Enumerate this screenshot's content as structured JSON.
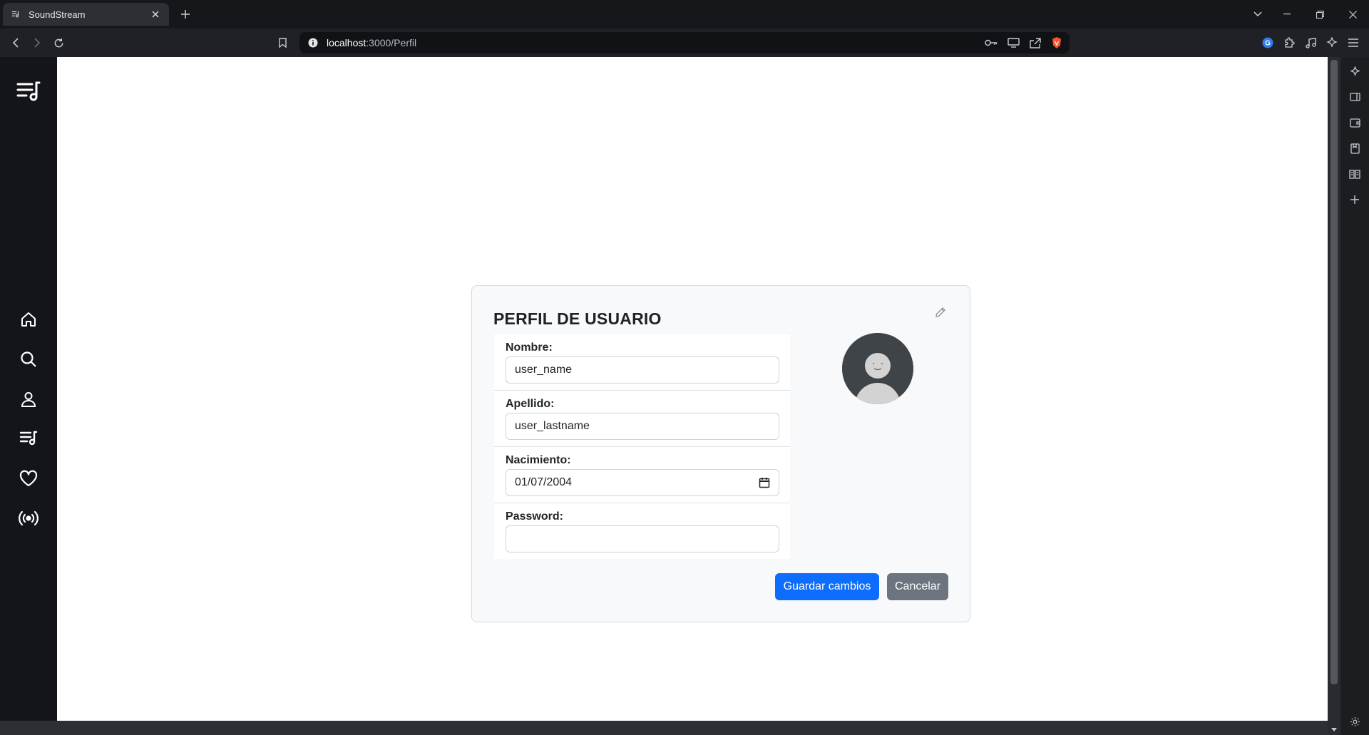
{
  "browser": {
    "tab_title": "SoundStream",
    "url_host": "localhost",
    "url_path": ":3000/Perfil"
  },
  "sidebar": {
    "items": [
      {
        "name": "home-icon"
      },
      {
        "name": "search-icon"
      },
      {
        "name": "user-icon"
      },
      {
        "name": "playlist-icon"
      },
      {
        "name": "heart-icon"
      },
      {
        "name": "broadcast-icon"
      }
    ]
  },
  "profile": {
    "title": "PERFIL DE USUARIO",
    "fields": [
      {
        "label": "Nombre:",
        "value": "user_name"
      },
      {
        "label": "Apellido:",
        "value": "user_lastname"
      },
      {
        "label": "Nacimiento:",
        "value": "01/07/2004"
      },
      {
        "label": "Password:",
        "value": ""
      }
    ],
    "save_label": "Guardar cambios",
    "cancel_label": "Cancelar"
  },
  "colors": {
    "primary": "#0d6efd",
    "secondary": "#6c757d",
    "sidebar_bg": "#14151a"
  }
}
